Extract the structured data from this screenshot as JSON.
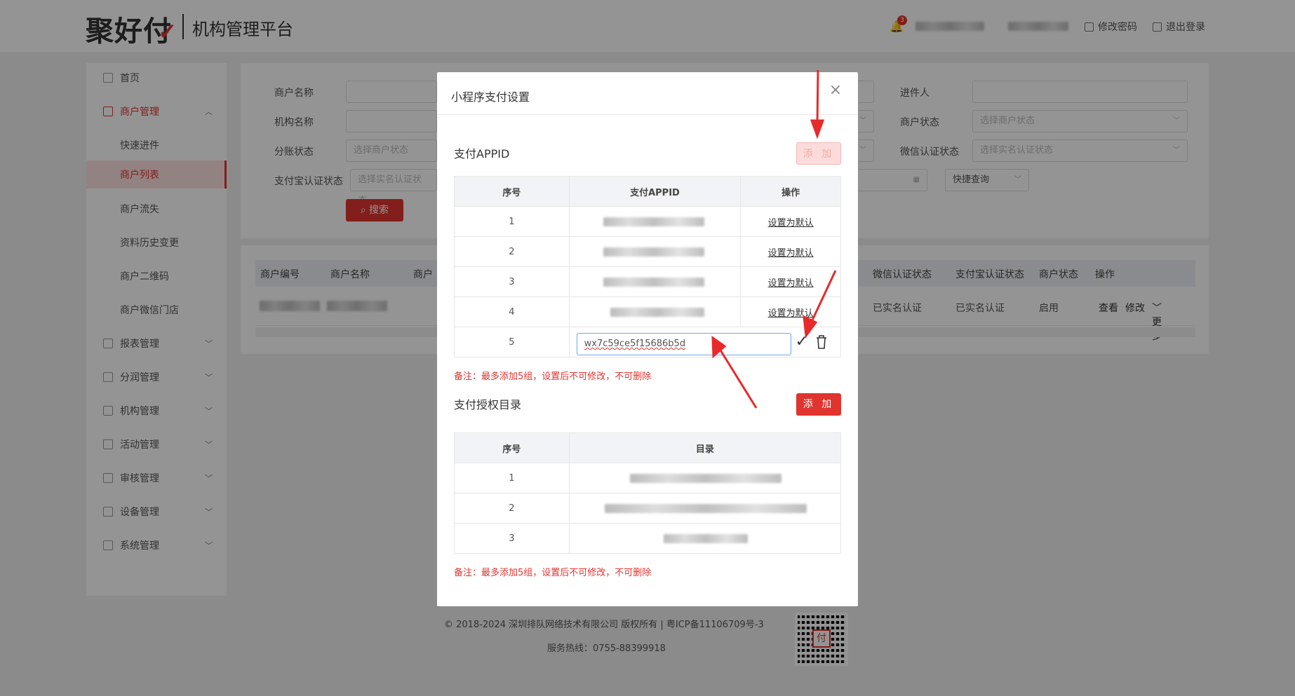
{
  "header": {
    "logo": "聚好付",
    "platform": "机构管理平台",
    "notification_count": "3",
    "change_password": "修改密码",
    "logout": "退出登录"
  },
  "sidebar": {
    "items": [
      {
        "label": "首页"
      },
      {
        "label": "商户管理"
      },
      {
        "label": "快速进件"
      },
      {
        "label": "商户列表"
      },
      {
        "label": "商户流失"
      },
      {
        "label": "资料历史变更"
      },
      {
        "label": "商户二维码"
      },
      {
        "label": "商户微信门店"
      },
      {
        "label": "报表管理"
      },
      {
        "label": "分润管理"
      },
      {
        "label": "机构管理"
      },
      {
        "label": "活动管理"
      },
      {
        "label": "审核管理"
      },
      {
        "label": "设备管理"
      },
      {
        "label": "系统管理"
      }
    ]
  },
  "filters": {
    "merchant_name": "商户名称",
    "org_name": "机构名称",
    "split_status": "分账状态",
    "split_status_ph": "选择商户状态",
    "alipay_status": "支付宝认证状态",
    "alipay_status_ph": "选择实名认证状态",
    "onboarder": "进件人",
    "merchant_status": "商户状态",
    "merchant_status_ph": "选择商户状态",
    "wechat_status": "微信认证状态",
    "wechat_status_ph": "选择实名认证状态",
    "quick_query": "快捷查询",
    "search_btn": "搜索"
  },
  "table": {
    "headers": [
      "商户编号",
      "商户名称",
      "商户",
      "微信认证状态",
      "支付宝认证状态",
      "商户状态",
      "操作"
    ],
    "row": {
      "wechat": "已实名认证",
      "alipay": "已实名认证",
      "status": "启用",
      "view": "查看",
      "edit": "修改",
      "more": "更多"
    }
  },
  "footer": {
    "copyright": "© 2018-2024 深圳排队网络技术有限公司 版权所有 | 粤ICP备11106709号-3",
    "hotline": "服务热线：0755-88399918",
    "qr_char": "付"
  },
  "modal": {
    "title": "小程序支付设置",
    "appid_section": "支付APPID",
    "add_label": "添 加",
    "appid_headers": [
      "序号",
      "支付APPID",
      "操作"
    ],
    "appid_rows": [
      {
        "no": "1",
        "action": "设置为默认"
      },
      {
        "no": "2",
        "action": "设置为默认"
      },
      {
        "no": "3",
        "action": "设置为默认"
      },
      {
        "no": "4",
        "action": "设置为默认"
      }
    ],
    "new_row_no": "5",
    "new_appid_value": "wx7c59ce5f15686b5d",
    "note": "备注：最多添加5组，设置后不可修改，不可删除",
    "dir_section": "支付授权目录",
    "dir_headers": [
      "序号",
      "目录"
    ],
    "dir_rows": [
      {
        "no": "1"
      },
      {
        "no": "2"
      },
      {
        "no": "3"
      }
    ],
    "note2": "备注：最多添加5组，设置后不可修改，不可删除"
  },
  "colors": {
    "accent": "#e0342f",
    "annotation_arrow": "#e82a2a"
  }
}
